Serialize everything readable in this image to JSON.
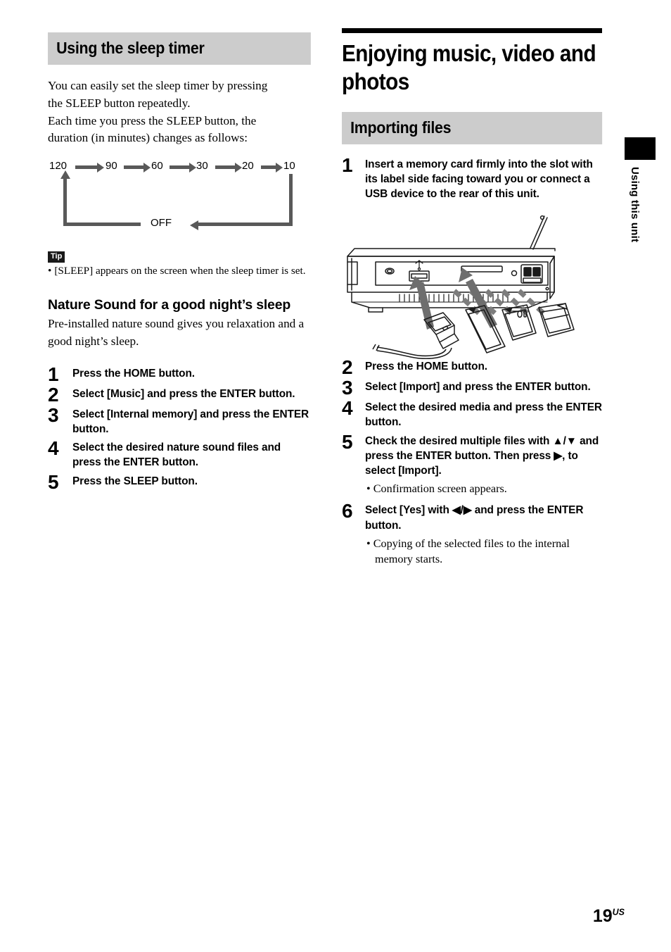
{
  "left_column": {
    "section_heading": "Using the sleep timer",
    "intro_paragraph_lines": [
      "You can easily set the sleep timer by pressing",
      "the SLEEP button repeatedly.",
      "Each time you press the SLEEP button, the",
      "duration (in minutes) changes as follows:"
    ],
    "flow_diagram": {
      "sequence": [
        "120",
        "90",
        "60",
        "30",
        "20",
        "10"
      ],
      "off_label": "OFF",
      "arrow_color": "#595959"
    },
    "tip": {
      "badge": "Tip",
      "bullet": "•",
      "text": "[SLEEP] appears on the screen when the sleep timer is set."
    },
    "sub_heading": "Nature Sound for a good night’s sleep",
    "sub_paragraph": "Pre-installed nature sound gives you relaxation and a good night’s sleep.",
    "steps": [
      {
        "num": "1",
        "text": "Press the HOME button."
      },
      {
        "num": "2",
        "text": "Select [Music] and press the ENTER button."
      },
      {
        "num": "3",
        "text": "Select [Internal memory] and press the ENTER button."
      },
      {
        "num": "4",
        "text": "Select the desired nature sound files and press the ENTER button."
      },
      {
        "num": "5",
        "text": "Press the SLEEP button."
      }
    ]
  },
  "right_column": {
    "chapter_title": "Enjoying music, video and photos",
    "section_heading": "Importing files",
    "step1": {
      "num": "1",
      "text": "Insert a memory card firmly into the slot with its label side facing toward you or connect a USB device to the rear of this unit."
    },
    "illustration_label": "rear-panel-usb-and-memory-card-slot-diagram",
    "steps": [
      {
        "num": "2",
        "text": "Press the HOME button.",
        "note": ""
      },
      {
        "num": "3",
        "text": "Select [Import] and press the ENTER button.",
        "note": ""
      },
      {
        "num": "4",
        "text": "Select the desired media and press the ENTER button.",
        "note": ""
      },
      {
        "num": "5",
        "text": "Check the desired multiple files with ▲/▼ and press the ENTER button. Then press ▶, to select [Import].",
        "note": "• Confirmation screen appears."
      },
      {
        "num": "6",
        "text": "Select [Yes] with ◀/▶ and press the ENTER button.",
        "note": "• Copying of the selected files to the internal memory starts."
      }
    ]
  },
  "side_tab": {
    "label": "Using this unit"
  },
  "footer": {
    "page_number": "19",
    "page_suffix": "US"
  },
  "colors": {
    "heading_bar": "#cccccc",
    "rule": "#000000",
    "diagram_gray": "#595959",
    "text": "#000000"
  }
}
